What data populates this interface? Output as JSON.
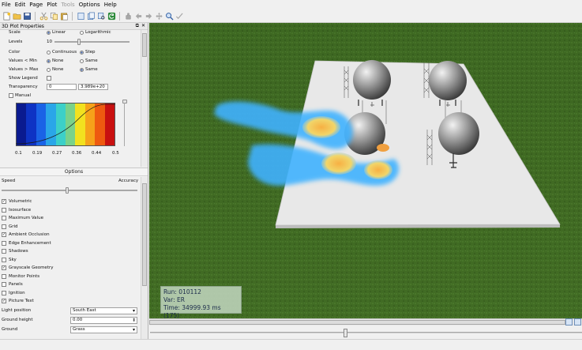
{
  "menu": {
    "items": [
      {
        "label": "File",
        "enabled": true
      },
      {
        "label": "Edit",
        "enabled": true
      },
      {
        "label": "Page",
        "enabled": true
      },
      {
        "label": "Plot",
        "enabled": true
      },
      {
        "label": "Tools",
        "enabled": false
      },
      {
        "label": "Options",
        "enabled": true
      },
      {
        "label": "Help",
        "enabled": true
      }
    ]
  },
  "plot_properties": {
    "title": "3D Plot Properties",
    "scale": {
      "label": "Scale",
      "options": [
        "Linear",
        "Logarithmic"
      ],
      "selected": "Linear"
    },
    "levels": {
      "label": "Levels",
      "value": "10"
    },
    "color": {
      "label": "Color",
      "options": [
        "Continuous",
        "Step"
      ],
      "selected": "Step"
    },
    "values_lt_min": {
      "label": "Values < Min",
      "options": [
        "None",
        "Same"
      ],
      "selected": "None"
    },
    "values_gt_max": {
      "label": "Values > Max",
      "options": [
        "None",
        "Same"
      ],
      "selected": "Same"
    },
    "show_legend": {
      "label": "Show Legend",
      "checked": false
    },
    "transparency": {
      "label": "Transparency",
      "min": "0",
      "max": "3.989e+20"
    },
    "manual": {
      "label": "Manual",
      "checked": false
    },
    "colorbar": {
      "colors": [
        "#0a1a8f",
        "#0e33c4",
        "#1a63e6",
        "#2aa6e8",
        "#3cd0c8",
        "#7ad28a",
        "#f2e11f",
        "#f6a21a",
        "#ee5a10",
        "#c81010"
      ],
      "tick_labels": [
        "0.1",
        "0.19",
        "0.27",
        "0.36",
        "0.44",
        "0.5"
      ]
    }
  },
  "options": {
    "title": "Options",
    "speed_label": "Speed",
    "accuracy_label": "Accuracy",
    "speed_level": 0.48,
    "checks": [
      {
        "label": "Volumetric",
        "checked": true
      },
      {
        "label": "Isosurface",
        "checked": false
      },
      {
        "label": "Maximum Value",
        "checked": false
      },
      {
        "label": "Grid",
        "checked": false
      },
      {
        "label": "Ambient Occlusion",
        "checked": true
      },
      {
        "label": "Edge Enhancement",
        "checked": false
      },
      {
        "label": "Shadows",
        "checked": false
      },
      {
        "label": "Sky",
        "checked": false
      },
      {
        "label": "Grayscale Geometry",
        "checked": true
      },
      {
        "label": "Monitor Points",
        "checked": false
      },
      {
        "label": "Panels",
        "checked": false
      },
      {
        "label": "Ignition",
        "checked": false
      },
      {
        "label": "Picture Text",
        "checked": true
      }
    ],
    "light_position": {
      "label": "Light position",
      "value": "South East"
    },
    "ground_height": {
      "label": "Ground height",
      "value": "0.00"
    },
    "ground": {
      "label": "Ground",
      "value": "Grass"
    }
  },
  "viewport": {
    "info": {
      "run": "Run: 010112",
      "var": "Var: ER",
      "time": "Time: 34999.93 ms (175)"
    },
    "colors": {
      "ground": "#3f6a22",
      "platform": "#e9e9e9",
      "plume_blue": "#3fb2ff",
      "plume_hot": "#f2a23a"
    }
  },
  "timeline": {
    "level": 0.45
  }
}
